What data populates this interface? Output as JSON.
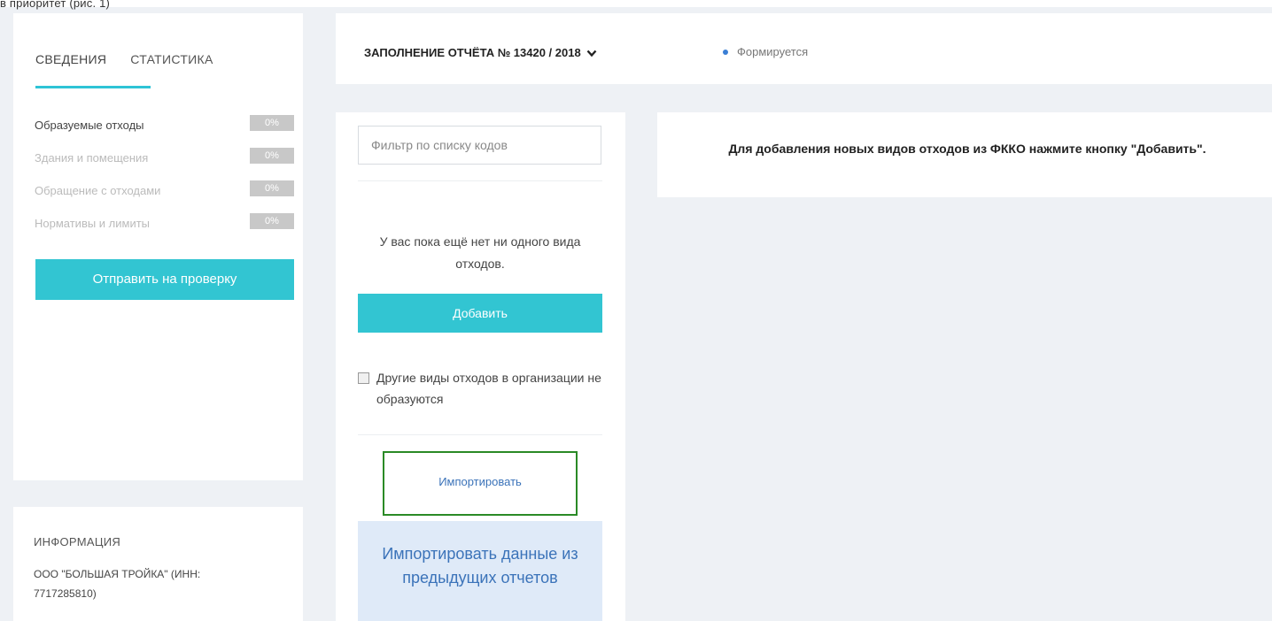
{
  "top": {
    "cut_text": "в приоритет (рис. 1)"
  },
  "sidebar": {
    "tabs": [
      {
        "label": "СВЕДЕНИЯ",
        "active": true
      },
      {
        "label": "СТАТИСТИКА",
        "active": false
      }
    ],
    "sections": [
      {
        "label": "Образуемые отходы",
        "percent": "0%"
      },
      {
        "label": "Здания и помещения",
        "percent": "0%"
      },
      {
        "label": "Обращение с отходами",
        "percent": "0%"
      },
      {
        "label": "Нормативы и лимиты",
        "percent": "0%"
      }
    ],
    "send_button": "Отправить на проверку"
  },
  "info": {
    "title": "ИНФОРМАЦИЯ",
    "org": "ООО \"БОЛЬШАЯ ТРОЙКА\" (ИНН: 7717285810)"
  },
  "header": {
    "report_title": "ЗАПОЛНЕНИЕ ОТЧЁТА № 13420 / 2018",
    "status": "Формируется",
    "status_color": "#3a7fd5"
  },
  "list": {
    "filter_placeholder": "Фильтр по списку кодов",
    "empty_message": "У вас пока ещё нет ни одного вида отходов.",
    "add_button": "Добавить",
    "checkbox_label": "Другие виды отходов в организации не образуются",
    "import_link": "Импортировать",
    "import_previous": "Импортировать данные из предыдущих отчетов"
  },
  "hint": {
    "text": "Для добавления новых видов отходов из ФККО нажмите кнопку \"Добавить\"."
  },
  "colors": {
    "accent": "#32c5d2",
    "import_border": "#2a8a26",
    "link": "#3b73b9"
  }
}
